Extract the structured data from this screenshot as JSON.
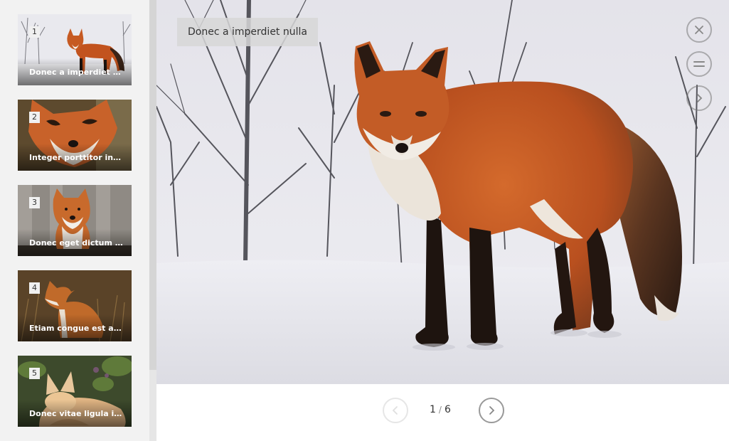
{
  "thumbnails": [
    {
      "number": "1",
      "caption": "Donec a imperdiet nu...",
      "subject": "red fox standing in snow"
    },
    {
      "number": "2",
      "caption": "Integer porttitor inter...",
      "subject": "red fox face close-up"
    },
    {
      "number": "3",
      "caption": "Donec eget dictum nisi",
      "subject": "fox sitting by wooden fence"
    },
    {
      "number": "4",
      "caption": "Etiam congue est a cu...",
      "subject": "fox sitting in dry grass"
    },
    {
      "number": "5",
      "caption": "Donec vitae ligula id ...",
      "subject": "fennec fox resting in leaves"
    }
  ],
  "viewer": {
    "title": "Donec a imperdiet nulla",
    "image_subject": "red fox standing in snow among bare trees"
  },
  "controls": {
    "close_icon": "close-icon",
    "menu_icon": "menu-icon",
    "next_icon": "chevron-right-icon"
  },
  "pagination": {
    "current": "1",
    "separator": "/",
    "total": "6"
  },
  "colors": {
    "fox_orange": "#c2531e",
    "snow": "#eeeef2",
    "sidebar_bg": "#f2f2f2"
  }
}
